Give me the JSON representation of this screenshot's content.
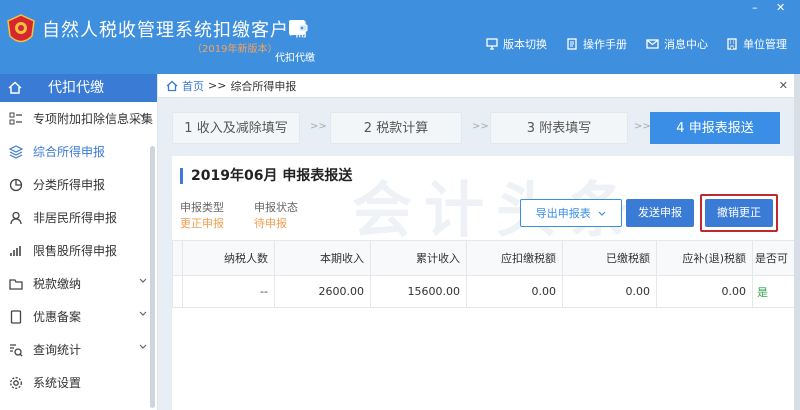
{
  "header": {
    "title": "自然人税收管理系统扣缴客户端",
    "version": "（2019年新版本）",
    "agent_label": "代扣代缴",
    "nav": [
      {
        "label": "版本切换",
        "icon": "monitor-icon"
      },
      {
        "label": "操作手册",
        "icon": "manual-icon"
      },
      {
        "label": "消息中心",
        "icon": "mail-icon"
      },
      {
        "label": "单位管理",
        "icon": "unit-icon"
      }
    ],
    "window_controls": [
      "–",
      "✕"
    ]
  },
  "sidebar": {
    "title": "代扣代缴",
    "items": [
      {
        "label": "专项附加扣除信息采集",
        "icon": "list-icon",
        "has_submenu": true
      },
      {
        "label": "综合所得申报",
        "icon": "layers-icon",
        "active": true
      },
      {
        "label": "分类所得申报",
        "icon": "pie-chart-icon"
      },
      {
        "label": "非居民所得申报",
        "icon": "person-icon"
      },
      {
        "label": "限售股所得申报",
        "icon": "bar-chart-icon"
      },
      {
        "label": "税款缴纳",
        "icon": "folder-icon",
        "has_submenu": true
      },
      {
        "label": "优惠备案",
        "icon": "document-icon",
        "has_submenu": true
      },
      {
        "label": "查询统计",
        "icon": "search-list-icon",
        "has_submenu": true
      },
      {
        "label": "系统设置",
        "icon": "gear-icon"
      }
    ]
  },
  "breadcrumb": {
    "home": "首页",
    "separator": ">>",
    "current": "综合所得申报",
    "close": "✕"
  },
  "steps": [
    {
      "label": "1 收入及减除填写"
    },
    {
      "label": "2 税款计算"
    },
    {
      "label": "3 附表填写"
    },
    {
      "label": "4 申报表报送",
      "active": true
    }
  ],
  "step_separator": ">>",
  "panel": {
    "title": "2019年06月  申报表报送",
    "watermark": "会计头条",
    "meta": [
      {
        "label": "申报类型",
        "value": "更正申报"
      },
      {
        "label": "申报状态",
        "value": "待申报"
      }
    ],
    "buttons": {
      "export": "导出申报表",
      "send": "发送申报",
      "cancel_correction": "撤销更正"
    },
    "table": {
      "headers": [
        "纳税人数",
        "本期收入",
        "累计收入",
        "应扣缴税额",
        "已缴税额",
        "应补(退)税额",
        "是否可"
      ],
      "rows": [
        [
          "--",
          "2600.00",
          "15600.00",
          "0.00",
          "0.00",
          "0.00",
          "是"
        ]
      ]
    }
  },
  "colors": {
    "brand_blue": "#3f8fdf",
    "active_blue": "#3a7bd5",
    "highlight_red": "#c0282e",
    "meta_orange": "#f0a050"
  }
}
